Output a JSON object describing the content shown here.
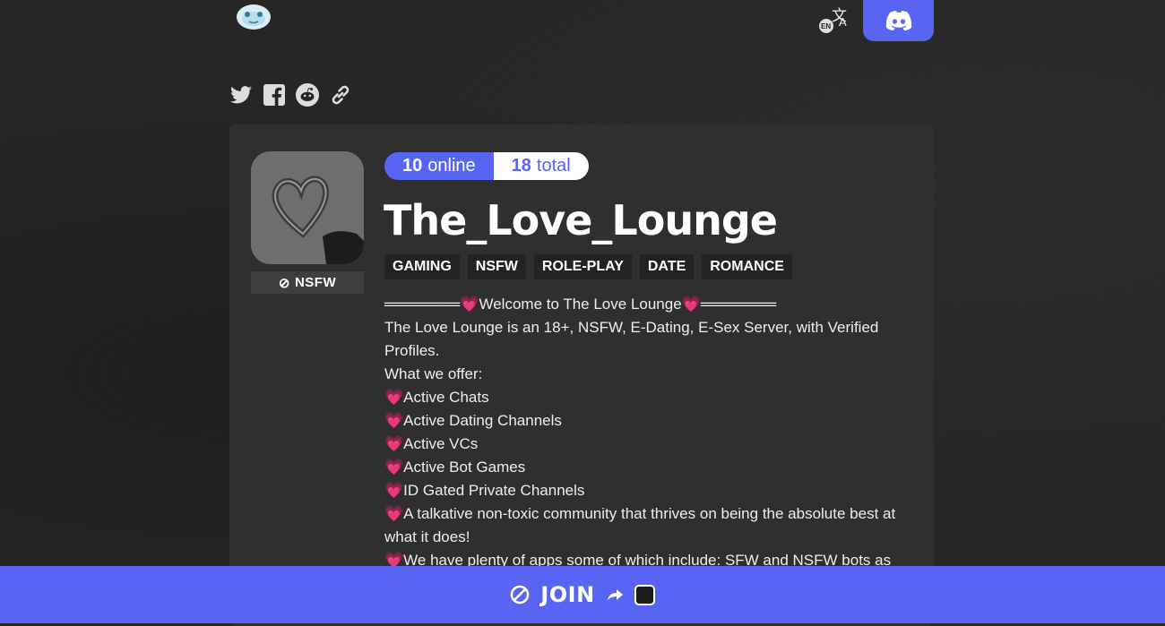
{
  "header": {
    "lang_code": "EN"
  },
  "counts": {
    "online_num": "10",
    "online_label": "online",
    "total_num": "18",
    "total_label": "total"
  },
  "server": {
    "nsfw_badge": "NSFW",
    "name": "The_Love_Lounge",
    "tags": [
      "GAMING",
      "NSFW",
      "ROLE-PLAY",
      "DATE",
      "ROMANCE"
    ],
    "description": [
      "═══════💗Welcome to The Love Lounge💗═══════",
      "The Love Lounge is an 18+, NSFW, E-Dating, E-Sex Server, with Verified Profiles.",
      "What we offer:",
      "💗Active Chats",
      "💗Active Dating Channels",
      "💗Active VCs",
      "💗Active Bot Games",
      "💗ID Gated Private Channels",
      "💗A talkative non-toxic community that thrives on being the absolute best at what it does!",
      "💗We have plenty of apps some of which include: SFW and NSFW bots as"
    ]
  },
  "join": {
    "label": "JOIN"
  },
  "colors": {
    "accent": "#5865f2",
    "card": "#2f2f2f",
    "background": "#262626"
  },
  "icons": [
    "logo-icon",
    "translate-icon",
    "discord-icon",
    "twitter-icon",
    "facebook-icon",
    "reddit-icon",
    "link-icon",
    "nsfw-icon",
    "external-arrow-icon"
  ]
}
